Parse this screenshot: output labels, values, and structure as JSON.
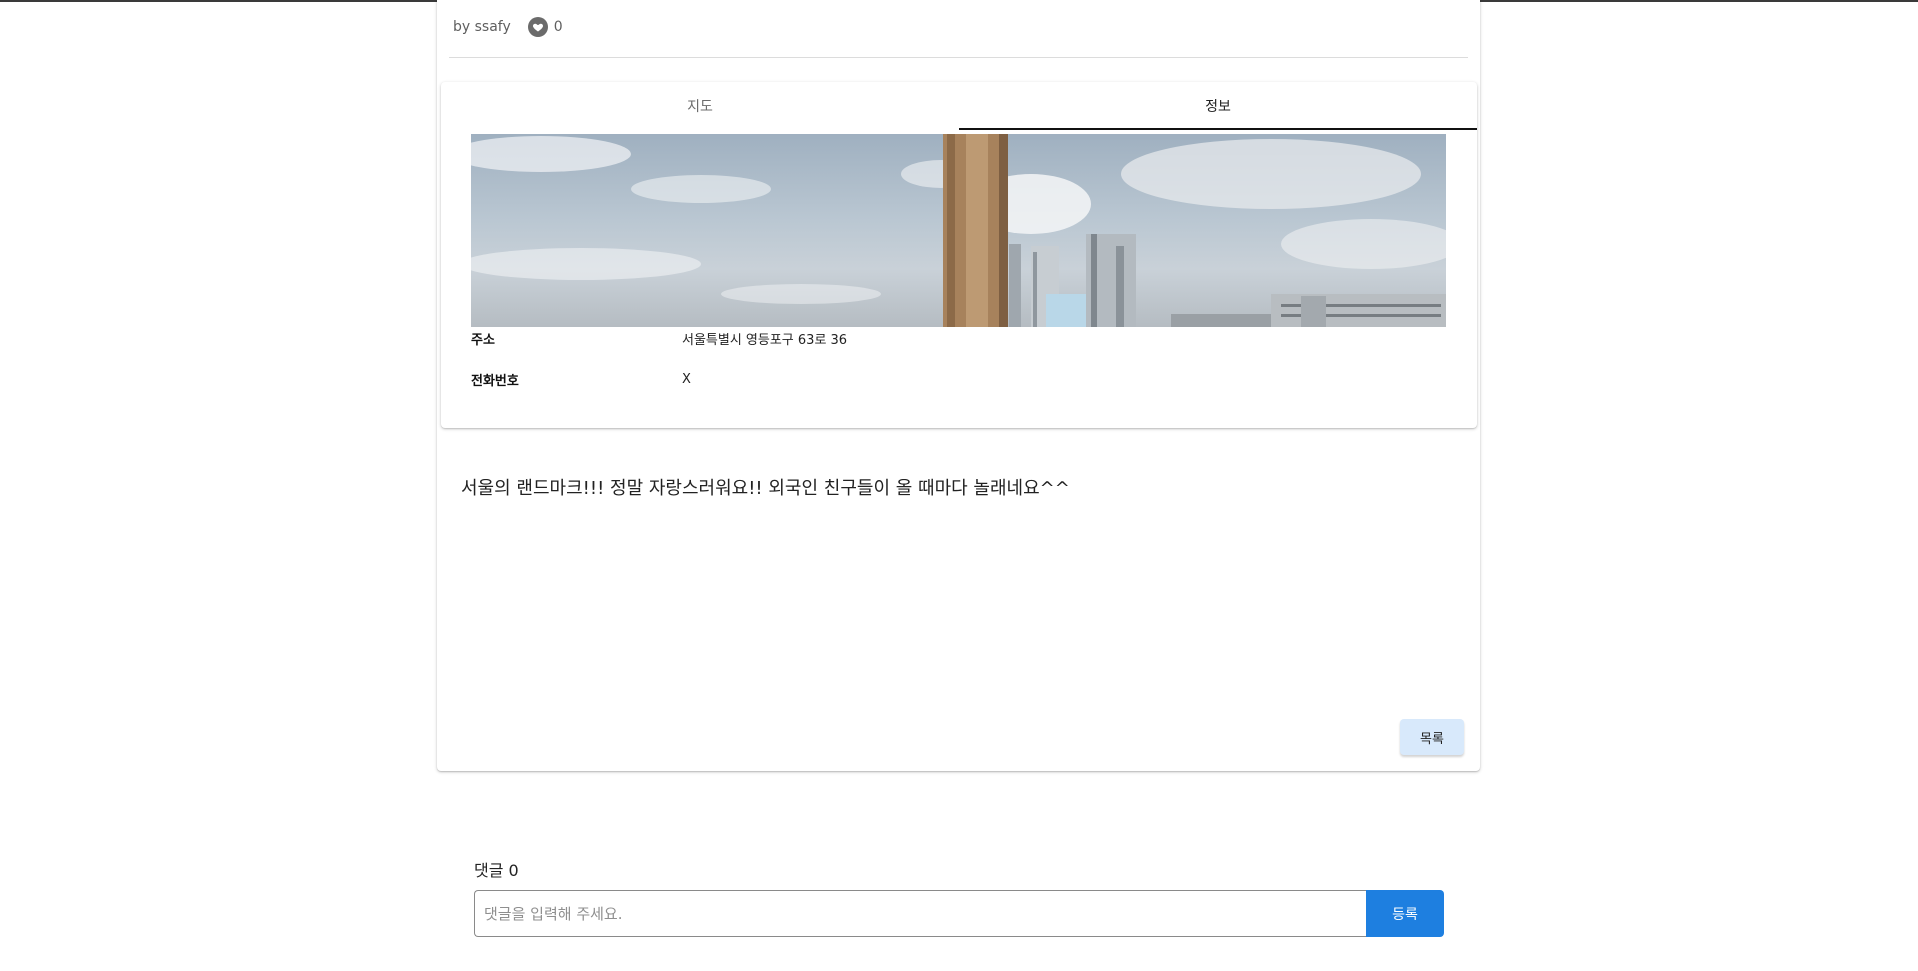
{
  "post": {
    "author": "by ssafy",
    "like_count": "0",
    "content": "서울의 랜드마크!!! 정말 자랑스러워요!! 외국인 친구들이 올 때마다 놀래네요^^"
  },
  "tabs": [
    {
      "label": "지도",
      "active": false
    },
    {
      "label": "정보",
      "active": true
    }
  ],
  "info": {
    "address_label": "주소",
    "address_value": "서울특별시 영등포구 63로 36",
    "phone_label": "전화번호",
    "phone_value": "X"
  },
  "actions": {
    "list_label": "목록"
  },
  "comments": {
    "count_label": "댓글 0",
    "input_value": "",
    "placeholder": "댓글을 입력해 주세요.",
    "submit_label": "등록"
  },
  "colors": {
    "accent": "#1e7fe0",
    "list_button": "#d8e9fb",
    "like_icon": "#6b6b6b"
  },
  "icons": {
    "like": "heart-icon"
  }
}
